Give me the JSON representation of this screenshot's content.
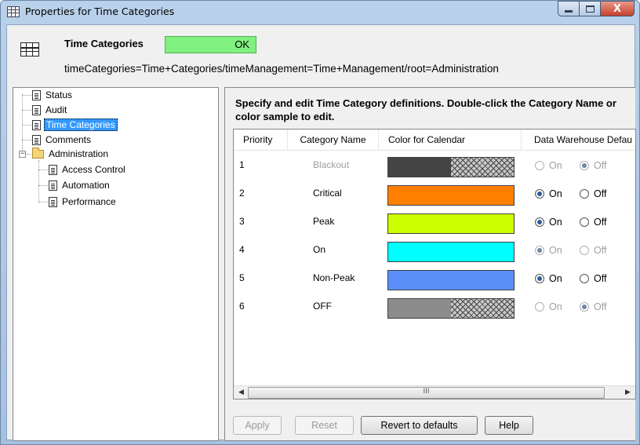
{
  "window": {
    "title": "Properties for Time Categories",
    "close_glyph": "X"
  },
  "header": {
    "title": "Time Categories",
    "status": "OK",
    "status_color": "#80f080",
    "path": "timeCategories=Time+Categories/timeManagement=Time+Management/root=Administration"
  },
  "tree": {
    "items": [
      {
        "label": "Status"
      },
      {
        "label": "Audit"
      },
      {
        "label": "Time Categories",
        "selected": true
      },
      {
        "label": "Comments"
      },
      {
        "label": "Administration",
        "expander": "−"
      },
      {
        "label": "Access Control"
      },
      {
        "label": "Automation"
      },
      {
        "label": "Performance"
      }
    ]
  },
  "main": {
    "instructions": "Specify and edit Time Category definitions.  Double-click the Category Name or color sample to edit.",
    "columns": [
      "Priority",
      "Category Name",
      "Color for Calendar",
      "Data Warehouse Defau"
    ],
    "on_label": "On",
    "off_label": "Off",
    "rows": [
      {
        "priority": "1",
        "name": "Blackout",
        "color": "#444444",
        "hatched": true,
        "dw": "off",
        "disabled": true
      },
      {
        "priority": "2",
        "name": "Critical",
        "color": "#ff8000",
        "hatched": false,
        "dw": "on",
        "disabled": false
      },
      {
        "priority": "3",
        "name": "Peak",
        "color": "#ccff00",
        "hatched": false,
        "dw": "on",
        "disabled": false
      },
      {
        "priority": "4",
        "name": "On",
        "color": "#00ffff",
        "hatched": false,
        "dw": "on",
        "disabled": false,
        "radios_disabled": true
      },
      {
        "priority": "5",
        "name": "Non-Peak",
        "color": "#5b8ff9",
        "hatched": false,
        "dw": "on",
        "disabled": false
      },
      {
        "priority": "6",
        "name": "OFF",
        "color": "#8c8c8c",
        "hatched": true,
        "dw": "off",
        "disabled": false,
        "radios_disabled": true
      }
    ],
    "scroll_left_glyph": "◀",
    "scroll_right_glyph": "▶",
    "scroll_thumb_glyph": "III"
  },
  "buttons": {
    "apply": "Apply",
    "reset": "Reset",
    "revert": "Revert to defaults",
    "help": "Help"
  }
}
